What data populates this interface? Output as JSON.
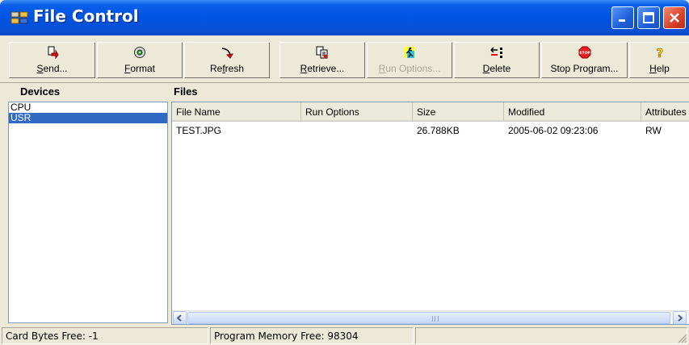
{
  "window": {
    "title": "File Control",
    "title_bar_color": "#0054e3",
    "controls": [
      "minimize-icon",
      "maximize-icon",
      "close-icon"
    ]
  },
  "toolbar": {
    "buttons": [
      {
        "mnemonic": "S",
        "rest": "end...",
        "icon": "send-icon",
        "enabled": true
      },
      {
        "mnemonic": "F",
        "rest": "ormat",
        "icon": "format-disk-icon",
        "enabled": true
      },
      {
        "pre": "Re",
        "mnemonic": "f",
        "rest": "resh",
        "icon": "refresh-icon",
        "enabled": true
      },
      {
        "mnemonic": "R",
        "rest": "etrieve...",
        "icon": "retrieve-icon",
        "enabled": true
      },
      {
        "mnemonic": "R",
        "rest": "un Options...",
        "icon": "run-options-icon",
        "enabled": false
      },
      {
        "mnemonic": "D",
        "rest": "elete",
        "icon": "delete-icon",
        "enabled": true
      },
      {
        "label": "Stop Program...",
        "icon": "stop-icon",
        "enabled": true
      },
      {
        "mnemonic": "H",
        "rest": "elp",
        "icon": "help-icon",
        "enabled": true
      }
    ]
  },
  "devices": {
    "header": "Devices",
    "items": [
      "CPU",
      "USR"
    ],
    "selected": "USR"
  },
  "files": {
    "header": "Files",
    "columns": [
      "File Name",
      "Run Options",
      "Size",
      "Modified",
      "Attributes"
    ],
    "rows": [
      {
        "name": "TEST.JPG",
        "run_options": "",
        "size": "26.788KB",
        "modified": "2005-06-02 09:23:06",
        "attributes": "RW"
      }
    ]
  },
  "status": {
    "card_bytes": "Card Bytes Free: -1",
    "program_memory": "Program Memory Free: 98304",
    "third": ""
  },
  "colors": {
    "selection": "#316ac5",
    "stop_red": "#e81c1c",
    "help_yellow": "#f8d80a"
  }
}
